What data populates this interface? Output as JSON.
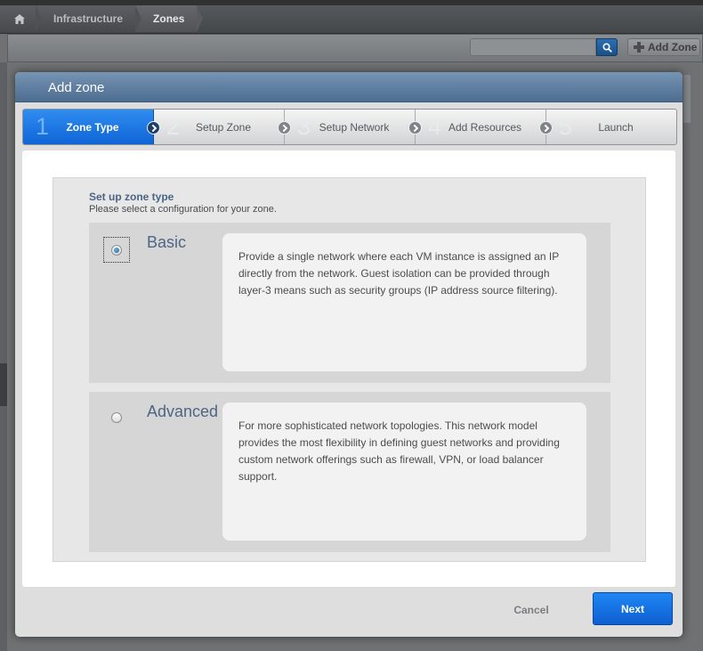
{
  "breadcrumb": {
    "home_icon": "home-icon",
    "items": [
      {
        "label": "Infrastructure"
      },
      {
        "label": "Zones"
      }
    ]
  },
  "toolbar": {
    "search_placeholder": "",
    "search_icon": "search-icon",
    "add_zone_label": "Add Zone"
  },
  "dialog": {
    "title": "Add zone",
    "steps": [
      {
        "number": "1",
        "label": "Zone Type",
        "active": true
      },
      {
        "number": "2",
        "label": "Setup Zone",
        "active": false
      },
      {
        "number": "3",
        "label": "Setup Network",
        "active": false
      },
      {
        "number": "4",
        "label": "Add Resources",
        "active": false
      },
      {
        "number": "5",
        "label": "Launch",
        "active": false
      }
    ],
    "section": {
      "title": "Set up zone type",
      "subtitle": "Please select a configuration for your zone."
    },
    "options": [
      {
        "title": "Basic",
        "selected": true,
        "description": "Provide a single network where each VM instance is assigned an IP directly from the network. Guest isolation can be provided through layer-3 means such as security groups (IP address source filtering)."
      },
      {
        "title": "Advanced",
        "selected": false,
        "description": "For more sophisticated network topologies. This network model provides the most flexibility in defining guest networks and providing custom network offerings such as firewall, VPN, or load balancer support."
      }
    ],
    "cancel_label": "Cancel",
    "next_label": "Next"
  },
  "colors": {
    "accent_blue": "#1572e4",
    "header_blue": "#5b7a9c",
    "title_text": "#4d6683"
  }
}
